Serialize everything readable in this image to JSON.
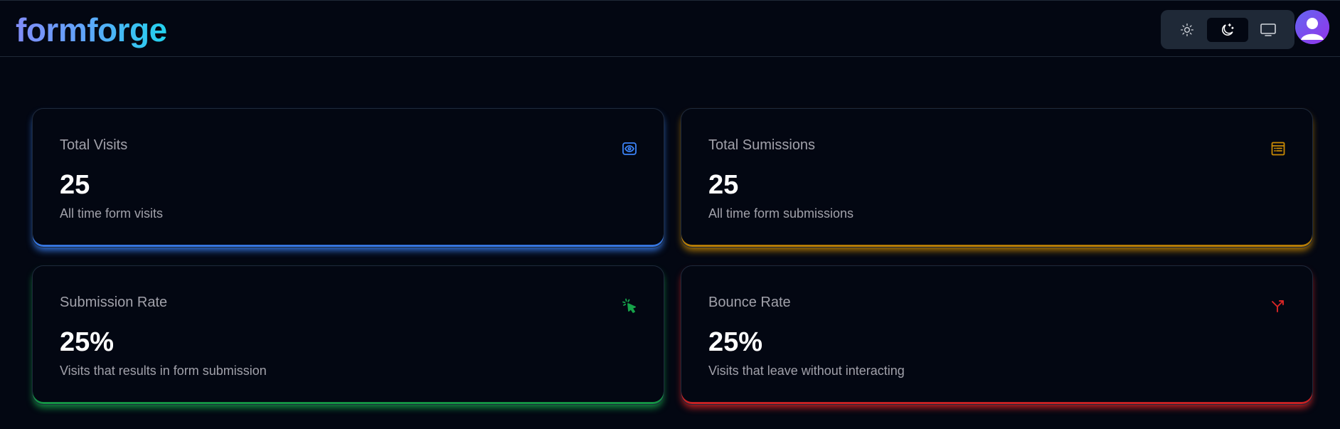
{
  "header": {
    "logo": "formforge",
    "theme_options": [
      {
        "name": "light",
        "icon": "sun-icon"
      },
      {
        "name": "dark",
        "icon": "moon-icon",
        "selected": true
      },
      {
        "name": "system",
        "icon": "monitor-icon"
      }
    ],
    "avatar_icon": "user-avatar-icon"
  },
  "stats": {
    "total_visits": {
      "title": "Total Visits",
      "value": "25",
      "description": "All time form visits",
      "icon": "eye-icon",
      "color": "#3b82f6"
    },
    "total_submissions": {
      "title": "Total Sumissions",
      "value": "25",
      "description": "All time form submissions",
      "icon": "form-icon",
      "color": "#ca8a04"
    },
    "submission_rate": {
      "title": "Submission Rate",
      "value": "25%",
      "description": "Visits that results in form submission",
      "icon": "cursor-click-icon",
      "color": "#16a34a"
    },
    "bounce_rate": {
      "title": "Bounce Rate",
      "value": "25%",
      "description": "Visits that leave without interacting",
      "icon": "split-arrow-icon",
      "color": "#dc2626"
    }
  }
}
